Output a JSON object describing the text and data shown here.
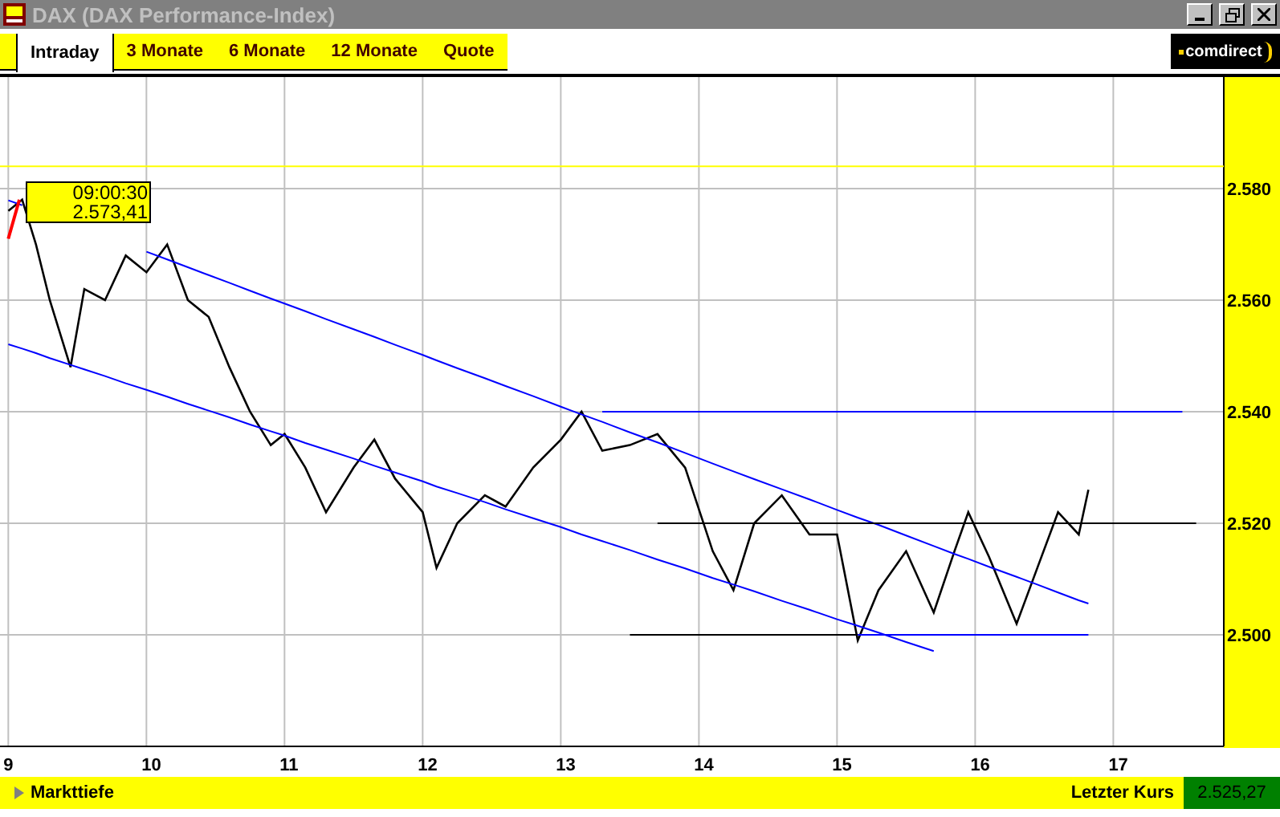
{
  "window": {
    "title": "DAX (DAX Performance-Index)"
  },
  "tabs": [
    {
      "label": "Intraday",
      "selected": true
    },
    {
      "label": "3 Monate",
      "selected": false
    },
    {
      "label": "6 Monate",
      "selected": false
    },
    {
      "label": "12 Monate",
      "selected": false
    },
    {
      "label": "Quote",
      "selected": false
    }
  ],
  "logo": {
    "text": "comdirect"
  },
  "chart": {
    "tooltip": {
      "time": "09:00:30",
      "value": "2.573,41"
    },
    "chart_data": {
      "type": "line",
      "grid": true,
      "x": [
        9.0,
        9.1,
        9.2,
        9.3,
        9.45,
        9.55,
        9.7,
        9.85,
        10.0,
        10.15,
        10.3,
        10.45,
        10.6,
        10.75,
        10.9,
        11.0,
        11.15,
        11.3,
        11.5,
        11.65,
        11.8,
        12.0,
        12.1,
        12.25,
        12.45,
        12.6,
        12.8,
        13.0,
        13.15,
        13.3,
        13.5,
        13.7,
        13.9,
        14.1,
        14.25,
        14.4,
        14.6,
        14.8,
        15.0,
        15.15,
        15.3,
        15.5,
        15.7,
        15.85,
        15.95,
        16.1,
        16.3,
        16.45,
        16.6,
        16.75,
        16.82,
        17.5,
        17.6
      ],
      "series": [
        {
          "color": "#000000",
          "values": [
            2576,
            2578,
            2570,
            2560,
            2548,
            2562,
            2560,
            2568,
            2565,
            2570,
            2560,
            2557,
            2548,
            2540,
            2534,
            2536,
            2530,
            2522,
            2530,
            2535,
            2528,
            2522,
            2512,
            2520,
            2525,
            2523,
            2530,
            2535,
            2540,
            2533,
            2534,
            2536,
            2530,
            2515,
            2508,
            2520,
            2525,
            2518,
            2518,
            2499,
            2508,
            2515,
            2504,
            2515,
            2522,
            2514,
            2502,
            2512,
            2522,
            2518,
            2526,
            null,
            null
          ]
        },
        {
          "color": "#0000ff",
          "values": [
            2577.9,
            2577.0,
            null,
            null,
            null,
            null,
            null,
            null,
            2568.7,
            2567.3,
            2565.9,
            2564.5,
            2563.1,
            2561.7,
            2560.3,
            2559.4,
            2558.0,
            2556.6,
            2554.8,
            2553.4,
            2552.0,
            2550.2,
            2549.2,
            2547.8,
            2546.0,
            2544.6,
            2542.8,
            2540.9,
            2539.5,
            2538.2,
            2536.3,
            2534.5,
            2532.6,
            2530.7,
            2529.3,
            2527.9,
            2526.1,
            2524.3,
            2522.4,
            2521.0,
            2519.7,
            2517.8,
            2515.9,
            2514.5,
            2513.6,
            2512.2,
            2510.4,
            2509.0,
            2507.6,
            2506.2,
            2505.6,
            null,
            null
          ]
        },
        {
          "color": "#0000ff",
          "values": [
            2552.1,
            2551.3,
            2550.5,
            2549.6,
            2548.4,
            2547.6,
            2546.4,
            2545.1,
            2543.9,
            2542.7,
            2541.4,
            2540.2,
            2539.0,
            2537.7,
            2536.5,
            2535.7,
            2534.4,
            2533.2,
            2531.6,
            2530.3,
            2529.1,
            2527.5,
            2526.6,
            2525.4,
            2523.8,
            2522.5,
            2520.9,
            2519.3,
            2518.0,
            2516.8,
            2515.2,
            2513.5,
            2511.9,
            2510.2,
            2509.0,
            2507.8,
            2506.1,
            2504.5,
            2502.8,
            2501.6,
            2500.4,
            2498.7,
            2497.1,
            null,
            null,
            null,
            null,
            null,
            null,
            null,
            null,
            null,
            null
          ]
        },
        {
          "color": "#0000ff",
          "values": [
            null,
            null,
            null,
            null,
            null,
            null,
            null,
            null,
            null,
            null,
            null,
            null,
            null,
            null,
            null,
            null,
            null,
            null,
            null,
            null,
            null,
            null,
            null,
            null,
            null,
            null,
            null,
            null,
            null,
            2540,
            2540,
            2540,
            2540,
            2540,
            2540,
            2540,
            2540,
            2540,
            2540,
            2540,
            2540,
            2540,
            2540,
            2540,
            2540,
            2540,
            2540,
            2540,
            2540,
            2540,
            2540,
            2540,
            null
          ]
        },
        {
          "color": "#000000",
          "values": [
            null,
            null,
            null,
            null,
            null,
            null,
            null,
            null,
            null,
            null,
            null,
            null,
            null,
            null,
            null,
            null,
            null,
            null,
            null,
            null,
            null,
            null,
            null,
            null,
            null,
            null,
            null,
            null,
            null,
            null,
            null,
            2520,
            2520,
            2520,
            2520,
            2520,
            2520,
            2520,
            2520,
            2520,
            2520,
            2520,
            2520,
            2520,
            2520,
            2520,
            2520,
            2520,
            2520,
            2520,
            2520,
            2520,
            2520
          ]
        },
        {
          "color": "#000000",
          "values": [
            null,
            null,
            null,
            null,
            null,
            null,
            null,
            null,
            null,
            null,
            null,
            null,
            null,
            null,
            null,
            null,
            null,
            null,
            null,
            null,
            null,
            null,
            null,
            null,
            null,
            null,
            null,
            null,
            null,
            null,
            2500,
            2500,
            2500,
            2500,
            2500,
            2500,
            2500,
            2500,
            2500,
            2500,
            null,
            null,
            null,
            null,
            null,
            null,
            null,
            null,
            null,
            null,
            null,
            null,
            null
          ]
        },
        {
          "color": "#0000ff",
          "values": [
            null,
            null,
            null,
            null,
            null,
            null,
            null,
            null,
            null,
            null,
            null,
            null,
            null,
            null,
            null,
            null,
            null,
            null,
            null,
            null,
            null,
            null,
            null,
            null,
            null,
            null,
            null,
            null,
            null,
            null,
            null,
            null,
            null,
            null,
            null,
            null,
            null,
            null,
            null,
            2500,
            2500,
            2500,
            2500,
            2500,
            2500,
            2500,
            2500,
            2500,
            2500,
            2500,
            2500,
            null,
            null
          ]
        }
      ],
      "ref_lines": [
        {
          "axis": "y",
          "value": 2584,
          "color": "#ffff00"
        }
      ],
      "xlim": [
        8.94,
        17.8
      ],
      "ylim": [
        2480,
        2600
      ],
      "xticks": [
        9,
        10,
        11,
        12,
        13,
        14,
        15,
        16,
        17
      ],
      "yticks": [
        {
          "value": 2500,
          "label": "2.500"
        },
        {
          "value": 2520,
          "label": "2.520"
        },
        {
          "value": 2540,
          "label": "2.540"
        },
        {
          "value": 2560,
          "label": "2.560"
        },
        {
          "value": 2580,
          "label": "2.580"
        }
      ]
    }
  },
  "footer": {
    "depth_label": "Markttiefe",
    "last_label": "Letzter Kurs",
    "last_value": "2.525,27"
  }
}
